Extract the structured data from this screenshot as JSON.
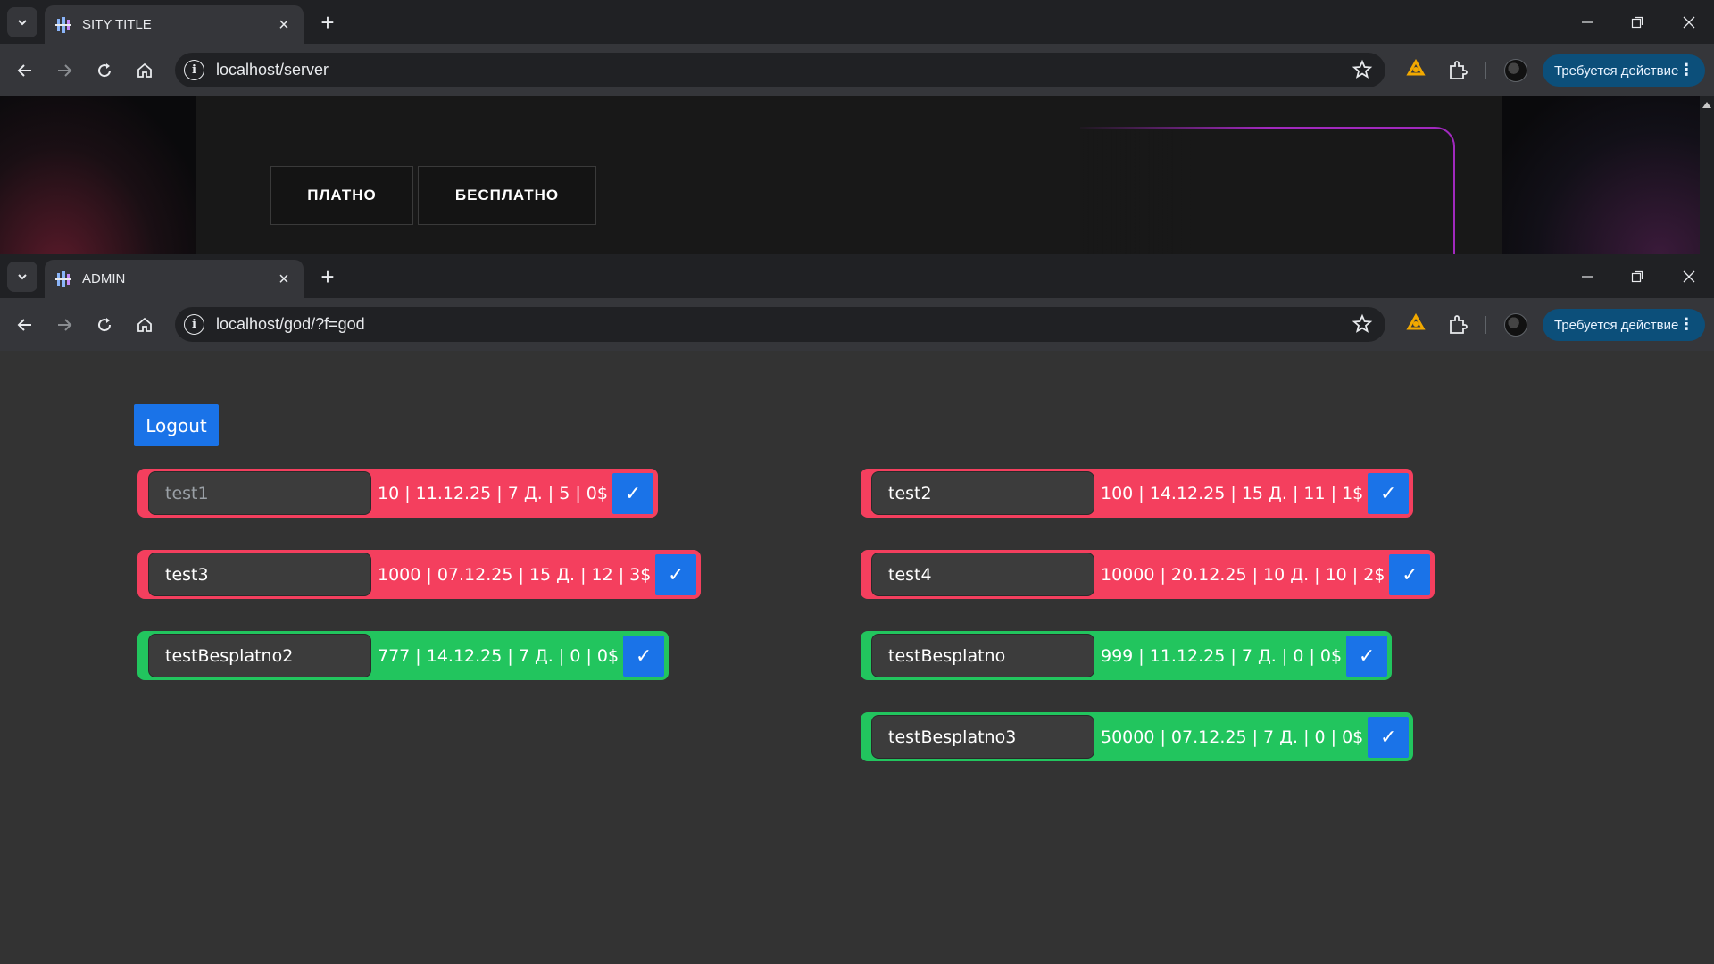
{
  "window1": {
    "tab_title": "SITY TITLE",
    "url": "localhost/server",
    "action_label": "Требуется действие",
    "site": {
      "buttons": [
        "ПЛАТНО",
        "БЕСПЛАТНО"
      ]
    }
  },
  "window2": {
    "tab_title": "ADMIN",
    "url": "localhost/god/?f=god",
    "action_label": "Требуется действие",
    "logout_label": "Logout",
    "check_glyph": "✓",
    "rows": [
      {
        "name": "",
        "placeholder": "test1",
        "info": "10 | 11.12.25 | 7 Д. | 5 | 0$",
        "type": "paid"
      },
      {
        "name": "test2",
        "placeholder": "",
        "info": "100 | 14.12.25 | 15 Д. | 11 | 1$",
        "type": "paid"
      },
      {
        "name": "test3",
        "placeholder": "",
        "info": "1000 | 07.12.25 | 15 Д. | 12 | 3$",
        "type": "paid"
      },
      {
        "name": "test4",
        "placeholder": "",
        "info": "10000 | 20.12.25 | 10 Д. | 10 | 2$",
        "type": "paid"
      },
      {
        "name": "testBesplatno2",
        "placeholder": "",
        "info": "777 | 14.12.25 | 7 Д. | 0 | 0$",
        "type": "free"
      },
      {
        "name": "testBesplatno",
        "placeholder": "",
        "info": "999 | 11.12.25 | 7 Д. | 0 | 0$",
        "type": "free"
      },
      {
        "name": "testBesplatno3",
        "placeholder": "",
        "info": "50000 | 07.12.25 | 7 Д. | 0 | 0$",
        "type": "free"
      }
    ]
  },
  "colors": {
    "paid": "#f43f5e",
    "free": "#22c55e",
    "accent": "#1a73e8"
  },
  "icons": [
    "tab-search-icon",
    "close-icon",
    "plus-icon",
    "minimize-icon",
    "restore-icon",
    "back-icon",
    "forward-icon",
    "reload-icon",
    "home-icon",
    "info-icon",
    "star-icon",
    "extension-icon",
    "puzzle-icon",
    "avatar",
    "more-vert-icon",
    "check-icon"
  ]
}
